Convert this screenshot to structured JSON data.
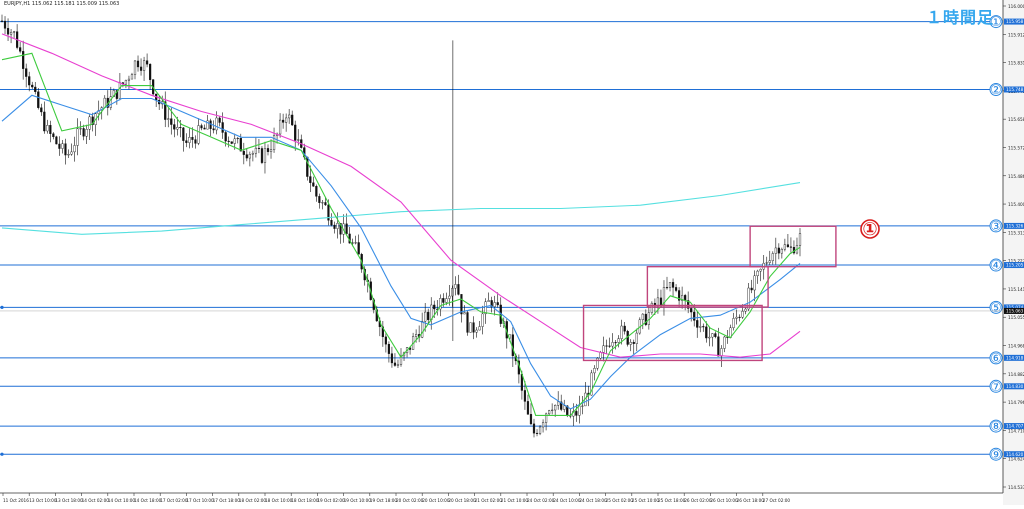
{
  "title": "EURJPY,H1  115.062 115.181 115.009 115.063",
  "timeframe_label": "１時間足",
  "colors": {
    "background": "#ffffff",
    "level_line": "#1f6fd6",
    "box": "#c0457c",
    "ma_fast": "#3ecb3e",
    "ma_mid": "#3a8ee6",
    "ma_slow": "#e83fd0",
    "ma_long": "#55e0e0",
    "marker": "#d81e1e",
    "candle": "#111111",
    "price_axis_bg": "#f4f4f4"
  },
  "chart_data": {
    "type": "candlestick",
    "symbol": "EURJPY",
    "timeframe": "H1",
    "ylim": [
      114.5,
      116.0
    ],
    "grid": false,
    "y_ticks": [
      "116.000",
      "115.912",
      "115.831",
      "115.745",
      "115.658",
      "115.572",
      "115.486",
      "115.400",
      "115.313",
      "115.227",
      "115.141",
      "115.055",
      "114.968",
      "114.882",
      "114.796",
      "114.710",
      "114.624",
      "114.537"
    ],
    "x_ticks": [
      "11 Oct 2016",
      "13 Oct 10:00",
      "13 Oct 18:00",
      "14 Oct 02:00",
      "14 Oct 10:00",
      "14 Oct 18:00",
      "17 Oct 02:00",
      "17 Oct 10:00",
      "17 Oct 18:00",
      "18 Oct 02:00",
      "18 Oct 10:00",
      "18 Oct 18:00",
      "19 Oct 02:00",
      "19 Oct 10:00",
      "19 Oct 18:00",
      "20 Oct 02:00",
      "20 Oct 10:00",
      "20 Oct 18:00",
      "21 Oct 02:00",
      "21 Oct 10:00",
      "24 Oct 02:00",
      "24 Oct 10:00",
      "24 Oct 18:00",
      "25 Oct 02:00",
      "25 Oct 10:00",
      "25 Oct 18:00",
      "26 Oct 02:00",
      "26 Oct 10:00",
      "26 Oct 18:00",
      "27 Oct 02:00"
    ],
    "levels": [
      {
        "label": "①",
        "price": 115.958,
        "price_text": "115.958"
      },
      {
        "label": "②",
        "price": 115.748,
        "price_text": "115.748"
      },
      {
        "label": "③",
        "price": 115.326,
        "price_text": "115.326"
      },
      {
        "label": "④",
        "price": 115.205,
        "price_text": "115.205"
      },
      {
        "label": "⑤",
        "price": 115.074,
        "price_text": "115.074"
      },
      {
        "label": "⑥",
        "price": 114.918,
        "price_text": "114.918"
      },
      {
        "label": "⑦",
        "price": 114.83,
        "price_text": "114.830"
      },
      {
        "label": "⑧",
        "price": 114.707,
        "price_text": "114.707"
      },
      {
        "label": "⑨",
        "price": 114.62,
        "price_text": "114.620"
      }
    ],
    "current_price": 115.063,
    "current_price_text": "115.063",
    "annotation": {
      "label": "①"
    },
    "boxes": [
      {
        "t0": 0.583,
        "t1": 0.762,
        "p_top": 115.08,
        "p_bot": 114.91
      },
      {
        "t0": 0.647,
        "t1": 0.768,
        "p_top": 115.2,
        "p_bot": 115.075
      },
      {
        "t0": 0.75,
        "t1": 0.836,
        "p_top": 115.325,
        "p_bot": 115.2
      }
    ],
    "close_path": [
      [
        0.0,
        115.96
      ],
      [
        0.012,
        115.92
      ],
      [
        0.025,
        115.8
      ],
      [
        0.035,
        115.7
      ],
      [
        0.045,
        115.62
      ],
      [
        0.055,
        115.58
      ],
      [
        0.065,
        115.54
      ],
      [
        0.075,
        115.6
      ],
      [
        0.085,
        115.64
      ],
      [
        0.095,
        115.68
      ],
      [
        0.11,
        115.72
      ],
      [
        0.125,
        115.78
      ],
      [
        0.135,
        115.84
      ],
      [
        0.145,
        115.82
      ],
      [
        0.155,
        115.72
      ],
      [
        0.17,
        115.64
      ],
      [
        0.185,
        115.58
      ],
      [
        0.2,
        115.62
      ],
      [
        0.215,
        115.64
      ],
      [
        0.23,
        115.59
      ],
      [
        0.245,
        115.56
      ],
      [
        0.26,
        115.54
      ],
      [
        0.275,
        115.6
      ],
      [
        0.285,
        115.68
      ],
      [
        0.295,
        115.6
      ],
      [
        0.305,
        115.5
      ],
      [
        0.315,
        115.42
      ],
      [
        0.325,
        115.38
      ],
      [
        0.335,
        115.33
      ],
      [
        0.345,
        115.3
      ],
      [
        0.355,
        115.25
      ],
      [
        0.365,
        115.17
      ],
      [
        0.375,
        115.06
      ],
      [
        0.385,
        114.95
      ],
      [
        0.395,
        114.89
      ],
      [
        0.405,
        114.93
      ],
      [
        0.415,
        114.99
      ],
      [
        0.425,
        115.04
      ],
      [
        0.435,
        115.08
      ],
      [
        0.445,
        115.12
      ],
      [
        0.455,
        115.16
      ],
      [
        0.462,
        115.05
      ],
      [
        0.47,
        115.0
      ],
      [
        0.48,
        115.04
      ],
      [
        0.49,
        115.1
      ],
      [
        0.5,
        115.04
      ],
      [
        0.51,
        114.96
      ],
      [
        0.518,
        114.86
      ],
      [
        0.525,
        114.76
      ],
      [
        0.532,
        114.68
      ],
      [
        0.54,
        114.72
      ],
      [
        0.55,
        114.78
      ],
      [
        0.56,
        114.76
      ],
      [
        0.57,
        114.73
      ],
      [
        0.58,
        114.76
      ],
      [
        0.59,
        114.84
      ],
      [
        0.6,
        114.92
      ],
      [
        0.61,
        114.98
      ],
      [
        0.62,
        115.0
      ],
      [
        0.63,
        114.97
      ],
      [
        0.64,
        115.02
      ],
      [
        0.65,
        115.06
      ],
      [
        0.66,
        115.1
      ],
      [
        0.67,
        115.14
      ],
      [
        0.68,
        115.11
      ],
      [
        0.69,
        115.06
      ],
      [
        0.7,
        115.02
      ],
      [
        0.71,
        114.98
      ],
      [
        0.72,
        114.94
      ],
      [
        0.73,
        115.01
      ],
      [
        0.74,
        115.06
      ],
      [
        0.75,
        115.12
      ],
      [
        0.76,
        115.18
      ],
      [
        0.77,
        115.24
      ],
      [
        0.78,
        115.27
      ],
      [
        0.79,
        115.25
      ],
      [
        0.8,
        115.29
      ]
    ],
    "ma_fast": [
      [
        0.0,
        115.84
      ],
      [
        0.03,
        115.86
      ],
      [
        0.06,
        115.62
      ],
      [
        0.09,
        115.64
      ],
      [
        0.12,
        115.76
      ],
      [
        0.15,
        115.76
      ],
      [
        0.18,
        115.64
      ],
      [
        0.21,
        115.6
      ],
      [
        0.24,
        115.56
      ],
      [
        0.27,
        115.59
      ],
      [
        0.3,
        115.56
      ],
      [
        0.33,
        115.38
      ],
      [
        0.36,
        115.22
      ],
      [
        0.38,
        115.02
      ],
      [
        0.4,
        114.92
      ],
      [
        0.42,
        114.99
      ],
      [
        0.44,
        115.08
      ],
      [
        0.46,
        115.1
      ],
      [
        0.48,
        115.06
      ],
      [
        0.5,
        115.05
      ],
      [
        0.52,
        114.88
      ],
      [
        0.535,
        114.74
      ],
      [
        0.55,
        114.74
      ],
      [
        0.57,
        114.74
      ],
      [
        0.59,
        114.81
      ],
      [
        0.61,
        114.94
      ],
      [
        0.63,
        114.99
      ],
      [
        0.65,
        115.04
      ],
      [
        0.67,
        115.11
      ],
      [
        0.69,
        115.09
      ],
      [
        0.71,
        115.01
      ],
      [
        0.73,
        114.98
      ],
      [
        0.75,
        115.06
      ],
      [
        0.77,
        115.17
      ],
      [
        0.79,
        115.24
      ],
      [
        0.8,
        115.26
      ]
    ],
    "ma_mid": [
      [
        0.0,
        115.65
      ],
      [
        0.03,
        115.73
      ],
      [
        0.06,
        115.7
      ],
      [
        0.09,
        115.67
      ],
      [
        0.12,
        115.72
      ],
      [
        0.15,
        115.72
      ],
      [
        0.18,
        115.68
      ],
      [
        0.21,
        115.64
      ],
      [
        0.24,
        115.6
      ],
      [
        0.27,
        115.6
      ],
      [
        0.3,
        115.56
      ],
      [
        0.33,
        115.45
      ],
      [
        0.36,
        115.32
      ],
      [
        0.39,
        115.14
      ],
      [
        0.41,
        115.04
      ],
      [
        0.43,
        115.02
      ],
      [
        0.46,
        115.06
      ],
      [
        0.49,
        115.08
      ],
      [
        0.51,
        115.03
      ],
      [
        0.53,
        114.9
      ],
      [
        0.55,
        114.8
      ],
      [
        0.57,
        114.76
      ],
      [
        0.59,
        114.79
      ],
      [
        0.61,
        114.86
      ],
      [
        0.63,
        114.92
      ],
      [
        0.66,
        114.99
      ],
      [
        0.69,
        115.04
      ],
      [
        0.72,
        115.05
      ],
      [
        0.75,
        115.09
      ],
      [
        0.78,
        115.16
      ],
      [
        0.8,
        115.21
      ]
    ],
    "ma_slow": [
      [
        0.0,
        115.92
      ],
      [
        0.05,
        115.86
      ],
      [
        0.1,
        115.79
      ],
      [
        0.15,
        115.73
      ],
      [
        0.2,
        115.68
      ],
      [
        0.25,
        115.64
      ],
      [
        0.3,
        115.58
      ],
      [
        0.35,
        115.51
      ],
      [
        0.4,
        115.4
      ],
      [
        0.45,
        115.22
      ],
      [
        0.5,
        115.11
      ],
      [
        0.54,
        115.03
      ],
      [
        0.58,
        114.95
      ],
      [
        0.62,
        114.92
      ],
      [
        0.66,
        114.93
      ],
      [
        0.7,
        114.93
      ],
      [
        0.74,
        114.92
      ],
      [
        0.77,
        114.93
      ],
      [
        0.8,
        115.0
      ]
    ],
    "ma_long": [
      [
        0.0,
        115.32
      ],
      [
        0.08,
        115.3
      ],
      [
        0.16,
        115.31
      ],
      [
        0.24,
        115.33
      ],
      [
        0.32,
        115.35
      ],
      [
        0.4,
        115.37
      ],
      [
        0.48,
        115.38
      ],
      [
        0.56,
        115.38
      ],
      [
        0.64,
        115.39
      ],
      [
        0.72,
        115.42
      ],
      [
        0.8,
        115.46
      ]
    ]
  }
}
